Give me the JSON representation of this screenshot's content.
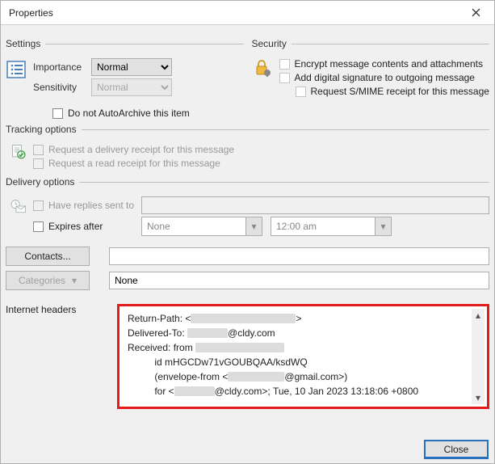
{
  "window": {
    "title": "Properties"
  },
  "groups": {
    "settings": "Settings",
    "security": "Security",
    "tracking": "Tracking options",
    "delivery": "Delivery options"
  },
  "settings": {
    "importance_label": "Importance",
    "importance_value": "Normal",
    "sensitivity_label": "Sensitivity",
    "sensitivity_value": "Normal",
    "no_autoarchive": "Do not AutoArchive this item"
  },
  "security": {
    "encrypt": "Encrypt message contents and attachments",
    "sign": "Add digital signature to outgoing message",
    "smime": "Request S/MIME receipt for this message"
  },
  "tracking": {
    "delivery_receipt": "Request a delivery receipt for this message",
    "read_receipt": "Request a read receipt for this message"
  },
  "delivery": {
    "replies_to": "Have replies sent to",
    "expires_after": "Expires after",
    "expires_date": "None",
    "expires_time": "12:00 am",
    "contacts_btn": "Contacts...",
    "categories_btn": "Categories",
    "categories_value": "None"
  },
  "internet_headers_label": "Internet headers",
  "headers": {
    "return_path_prefix": "Return-Path: <",
    "return_path_suffix": ">",
    "delivered_prefix": "Delivered-To: ",
    "delivered_suffix": "@cldy.com",
    "received_prefix": "Received: from ",
    "id_line": "          id mHGCDw71vGOUBQAA/ksdWQ",
    "envelope_prefix": "          (envelope-from <",
    "envelope_suffix": "@gmail.com>)",
    "for_prefix": "          for <",
    "for_mid": "@cldy.com>; ",
    "for_date": "Tue, 10 Jan 2023 13:18:06 +0800"
  },
  "close_btn": "Close"
}
